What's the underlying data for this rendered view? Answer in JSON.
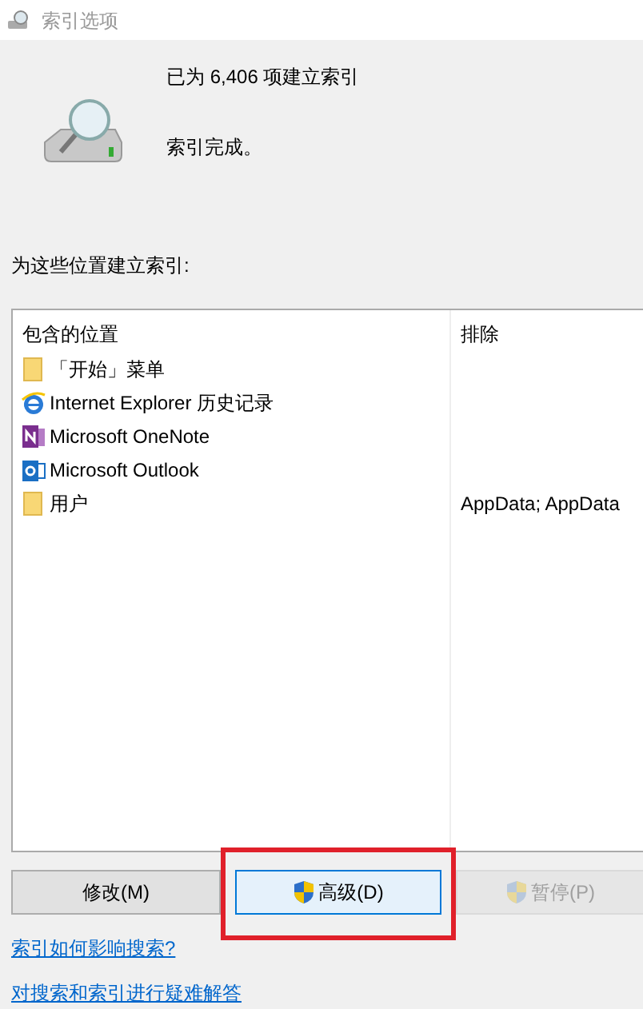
{
  "window": {
    "title": "索引选项"
  },
  "status": {
    "count_text": "已为 6,406 项建立索引",
    "state_text": "索引完成。"
  },
  "locations_label": "为这些位置建立索引:",
  "table": {
    "columns": [
      "包含的位置",
      "排除"
    ],
    "rows": [
      {
        "kind": "folder",
        "location": "「开始」菜单",
        "exclude": ""
      },
      {
        "kind": "ie",
        "location": "Internet Explorer 历史记录",
        "exclude": ""
      },
      {
        "kind": "onenote",
        "location": "Microsoft OneNote",
        "exclude": ""
      },
      {
        "kind": "outlook",
        "location": "Microsoft Outlook",
        "exclude": ""
      },
      {
        "kind": "folder",
        "location": "用户",
        "exclude": "AppData; AppData"
      }
    ]
  },
  "buttons": [
    {
      "label": "修改(M)",
      "shield": false,
      "highlighted": false,
      "disabled": false,
      "annotated": false
    },
    {
      "label": "高级(D)",
      "shield": true,
      "highlighted": true,
      "disabled": false,
      "annotated": true
    },
    {
      "label": "暂停(P)",
      "shield": true,
      "highlighted": false,
      "disabled": true,
      "annotated": false
    }
  ],
  "links": [
    "索引如何影响搜索?",
    "对搜索和索引进行疑难解答"
  ]
}
